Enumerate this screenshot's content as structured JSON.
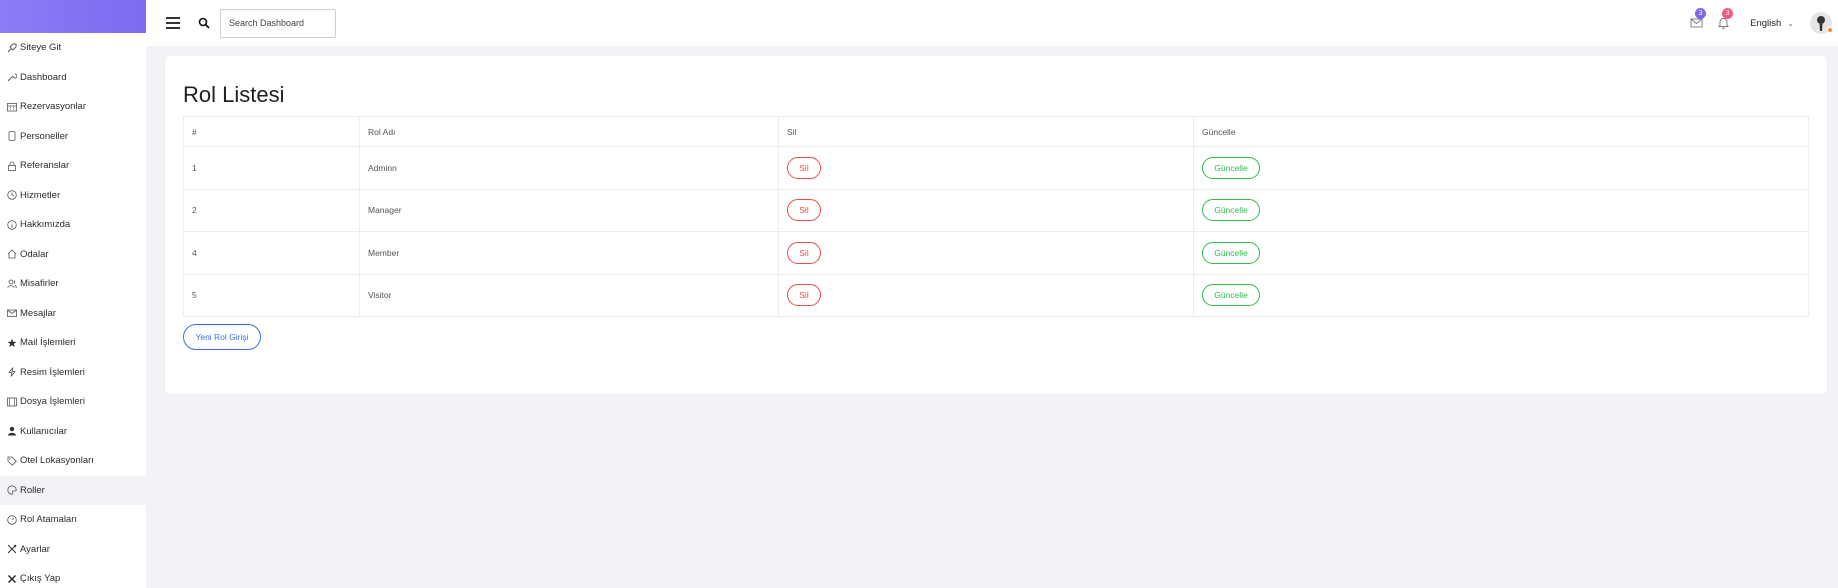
{
  "sidebar": {
    "items": [
      {
        "label": "Siteye Git",
        "icon": "rocket-icon"
      },
      {
        "label": "Dashboard",
        "icon": "wrench-icon"
      },
      {
        "label": "Rezervasyonlar",
        "icon": "calendar-icon"
      },
      {
        "label": "Personeller",
        "icon": "phone-icon"
      },
      {
        "label": "Referanslar",
        "icon": "lock-icon"
      },
      {
        "label": "Hizmetler",
        "icon": "clock-icon"
      },
      {
        "label": "Hakkımızda",
        "icon": "info-icon"
      },
      {
        "label": "Odalar",
        "icon": "home-icon"
      },
      {
        "label": "Misafirler",
        "icon": "users-icon"
      },
      {
        "label": "Mesajlar",
        "icon": "envelope-icon"
      },
      {
        "label": "Mail İşlemleri",
        "icon": "star-icon"
      },
      {
        "label": "Resim İşlemleri",
        "icon": "bolt-icon"
      },
      {
        "label": "Dosya İşlemleri",
        "icon": "film-icon"
      },
      {
        "label": "Kullanıcılar",
        "icon": "user-icon"
      },
      {
        "label": "Otel Lokasyonları",
        "icon": "tag-icon"
      },
      {
        "label": "Roller",
        "icon": "palette-icon"
      },
      {
        "label": "Rol Atamaları",
        "icon": "gauge-icon"
      },
      {
        "label": "Ayarlar",
        "icon": "tools-icon"
      },
      {
        "label": "Çıkış Yap",
        "icon": "x-icon"
      }
    ],
    "active_index": 15
  },
  "header": {
    "search_placeholder": "Search Dashboard",
    "mail_count": "3",
    "notification_count": "3",
    "language": "English"
  },
  "main": {
    "title": "Rol Listesi",
    "table": {
      "columns": [
        "#",
        "Rol Adı",
        "Sil",
        "Güncelle"
      ],
      "rows": [
        {
          "id": "1",
          "name": "Adminn",
          "delete_label": "Sil",
          "update_label": "Güncelle"
        },
        {
          "id": "2",
          "name": "Manager",
          "delete_label": "Sil",
          "update_label": "Güncelle"
        },
        {
          "id": "4",
          "name": "Member",
          "delete_label": "Sil",
          "update_label": "Güncelle"
        },
        {
          "id": "5",
          "name": "Visitor",
          "delete_label": "Sil",
          "update_label": "Güncelle"
        }
      ]
    },
    "new_button_label": "Yeni Rol Girişi"
  },
  "colors": {
    "brand": "#8b7cf6",
    "delete": "#e84a4a",
    "update": "#2fbb4a",
    "primary": "#3d6fe8",
    "background": "#f2f2f7"
  }
}
